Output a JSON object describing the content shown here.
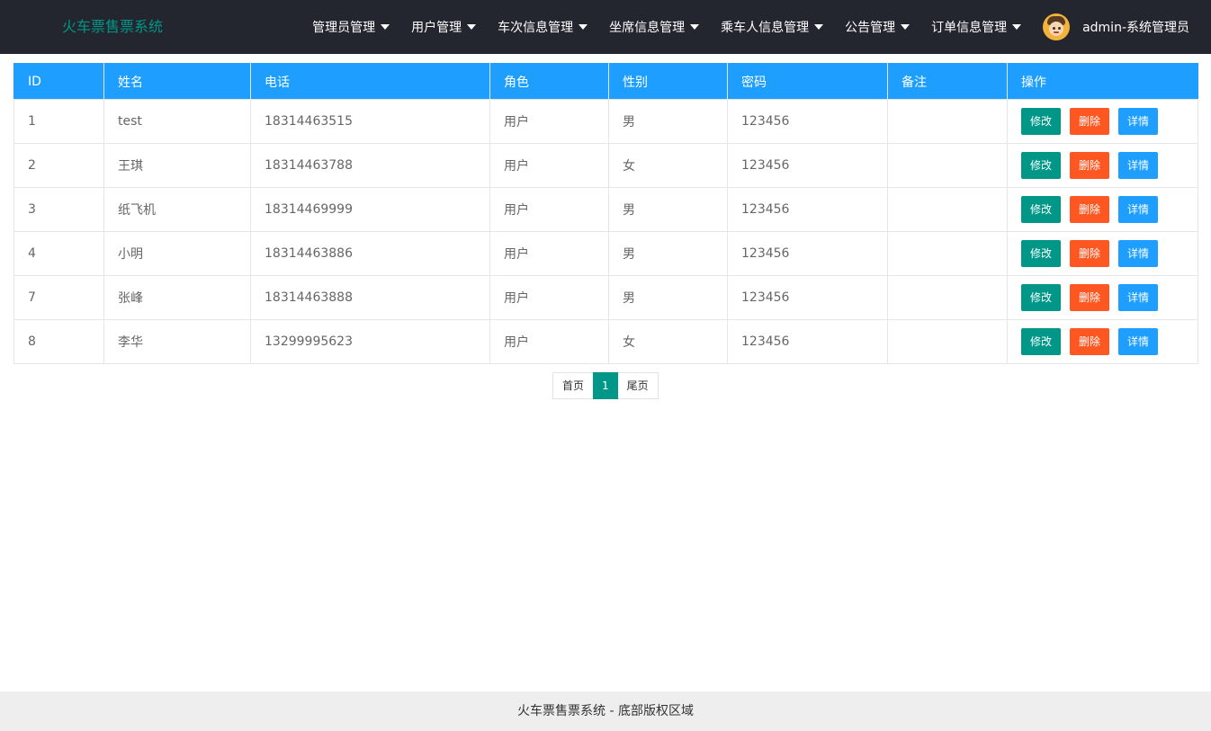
{
  "header": {
    "logo": "火车票售票系统",
    "nav": [
      "管理员管理",
      "用户管理",
      "车次信息管理",
      "坐席信息管理",
      "乘车人信息管理",
      "公告管理",
      "订单信息管理"
    ],
    "user": "admin-系统管理员"
  },
  "table": {
    "columns": [
      "ID",
      "姓名",
      "电话",
      "角色",
      "性别",
      "密码",
      "备注",
      "操作"
    ],
    "rows": [
      {
        "id": "1",
        "name": "test",
        "phone": "18314463515",
        "role": "用户",
        "gender": "男",
        "password": "123456",
        "note": ""
      },
      {
        "id": "2",
        "name": "王琪",
        "phone": "18314463788",
        "role": "用户",
        "gender": "女",
        "password": "123456",
        "note": ""
      },
      {
        "id": "3",
        "name": "纸飞机",
        "phone": "18314469999",
        "role": "用户",
        "gender": "男",
        "password": "123456",
        "note": ""
      },
      {
        "id": "4",
        "name": "小明",
        "phone": "18314463886",
        "role": "用户",
        "gender": "男",
        "password": "123456",
        "note": ""
      },
      {
        "id": "7",
        "name": "张峰",
        "phone": "18314463888",
        "role": "用户",
        "gender": "男",
        "password": "123456",
        "note": ""
      },
      {
        "id": "8",
        "name": "李华",
        "phone": "13299995623",
        "role": "用户",
        "gender": "女",
        "password": "123456",
        "note": ""
      }
    ],
    "actions": {
      "edit": "修改",
      "delete": "删除",
      "detail": "详情"
    }
  },
  "pagination": {
    "first": "首页",
    "current": "1",
    "last": "尾页"
  },
  "footer": {
    "text": "火车票售票系统 - 底部版权区域"
  },
  "colors": {
    "topbar": "#23262e",
    "logo": "#009688",
    "table_header": "#1e9fff",
    "edit_button": "#009688",
    "delete_button": "#ff5722",
    "detail_button": "#1e9fff"
  },
  "icons": {
    "nav_dropdown": "caret-down-icon",
    "avatar": "avatar-icon"
  }
}
